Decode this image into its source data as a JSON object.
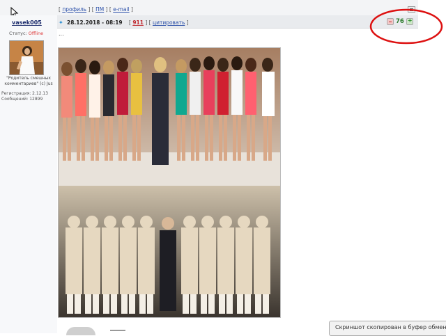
{
  "top_links": {
    "profile": "профиль",
    "pm": "ПМ",
    "email": "e-mail",
    "separator": "] ["
  },
  "user": {
    "name": "vasek005",
    "status_label": "Статус:",
    "status_value": "Offline",
    "signature": "\"Родитель смешных комментариев\" (с) Jus",
    "registration": "Регистрация: 2.12.13",
    "messages": "Сообщений: 12899"
  },
  "post": {
    "icon": "post-icon",
    "datetime": "28.12.2018 - 08:19",
    "number": "911",
    "quote_label": "цитировать",
    "body_text": "...",
    "rating_value": "76"
  },
  "toast": {
    "text": "Скриншот скопирован в буфер обмена"
  },
  "colors": {
    "offline": "#dd3333",
    "post_number": "#c0282e",
    "rating": "#2b7a2b",
    "annotation_circle": "#dd1111"
  }
}
